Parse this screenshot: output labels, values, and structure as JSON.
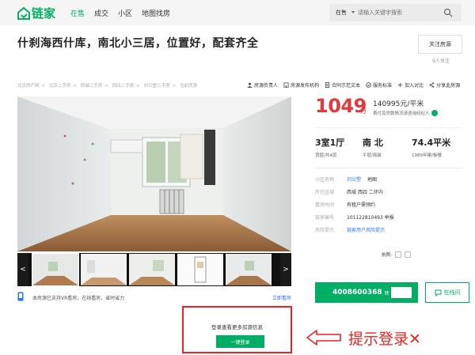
{
  "brand": {
    "name": "链家",
    "color": "#00ae66"
  },
  "nav": [
    {
      "label": "在售",
      "active": true
    },
    {
      "label": "成交",
      "active": false
    },
    {
      "label": "小区",
      "active": false
    },
    {
      "label": "地图找房",
      "active": false
    }
  ],
  "search": {
    "type_label": "在售",
    "placeholder": "请输入关键字搜索",
    "icon": "search-icon"
  },
  "listing": {
    "title": "什刹海西什库，南北小三居，位置好，配套齐全",
    "follow_label": "关注房源",
    "follow_count": "9人关注"
  },
  "breadcrumb": [
    "北京房产网",
    "北京二手房",
    "西城二手房",
    "西四二手房",
    "刘兰塑二手房",
    "当前房源"
  ],
  "tools": [
    {
      "label": "房源负责人",
      "icon": "person-icon"
    },
    {
      "label": "房源发布机构",
      "icon": "building-icon"
    },
    {
      "label": "合同示范文本",
      "icon": "document-icon"
    },
    {
      "label": "服务标准",
      "icon": "badge-icon"
    },
    {
      "label": "加入对比",
      "icon": "compare-icon"
    },
    {
      "label": "分享此房源",
      "icon": "share-icon"
    }
  ],
  "gallery": {
    "prev_label": "<",
    "next_label": ">",
    "vr_text": "本房源已支持VR看房，在线看房，省时省力",
    "vr_link": "立即看房"
  },
  "price": {
    "total": "1049",
    "unit": "万",
    "per_sqm": "140995元/平米",
    "note": "首付及贷款情况请咨询经纪人"
  },
  "specs": [
    {
      "main": "3室1厅",
      "sub": "顶层/共4层"
    },
    {
      "main": "南 北",
      "sub": "平层/简装"
    },
    {
      "main": "74.4平米",
      "sub": "1989年建/板楼"
    }
  ],
  "info": {
    "community_label": "小区名称",
    "community_value": "刘兰塑",
    "community_map": "地图",
    "area_label": "所在区域",
    "area_value": "西城 西四 二环内",
    "visit_label": "看房时间",
    "visit_value": "有租户需预约",
    "id_label": "链家编号",
    "id_value": "101122810493 举报",
    "risk_label": "风险提示",
    "risk_value": "链家用户风险提示"
  },
  "agent": {
    "cert_label": "执照:",
    "phone": "4008600368",
    "phone_ext": "转",
    "online_label": "在线问"
  },
  "login": {
    "prompt": "登录查看更多房源信息",
    "button": "一键登录",
    "annotation": "提示登录✕",
    "annotation_color": "#ee2222"
  }
}
